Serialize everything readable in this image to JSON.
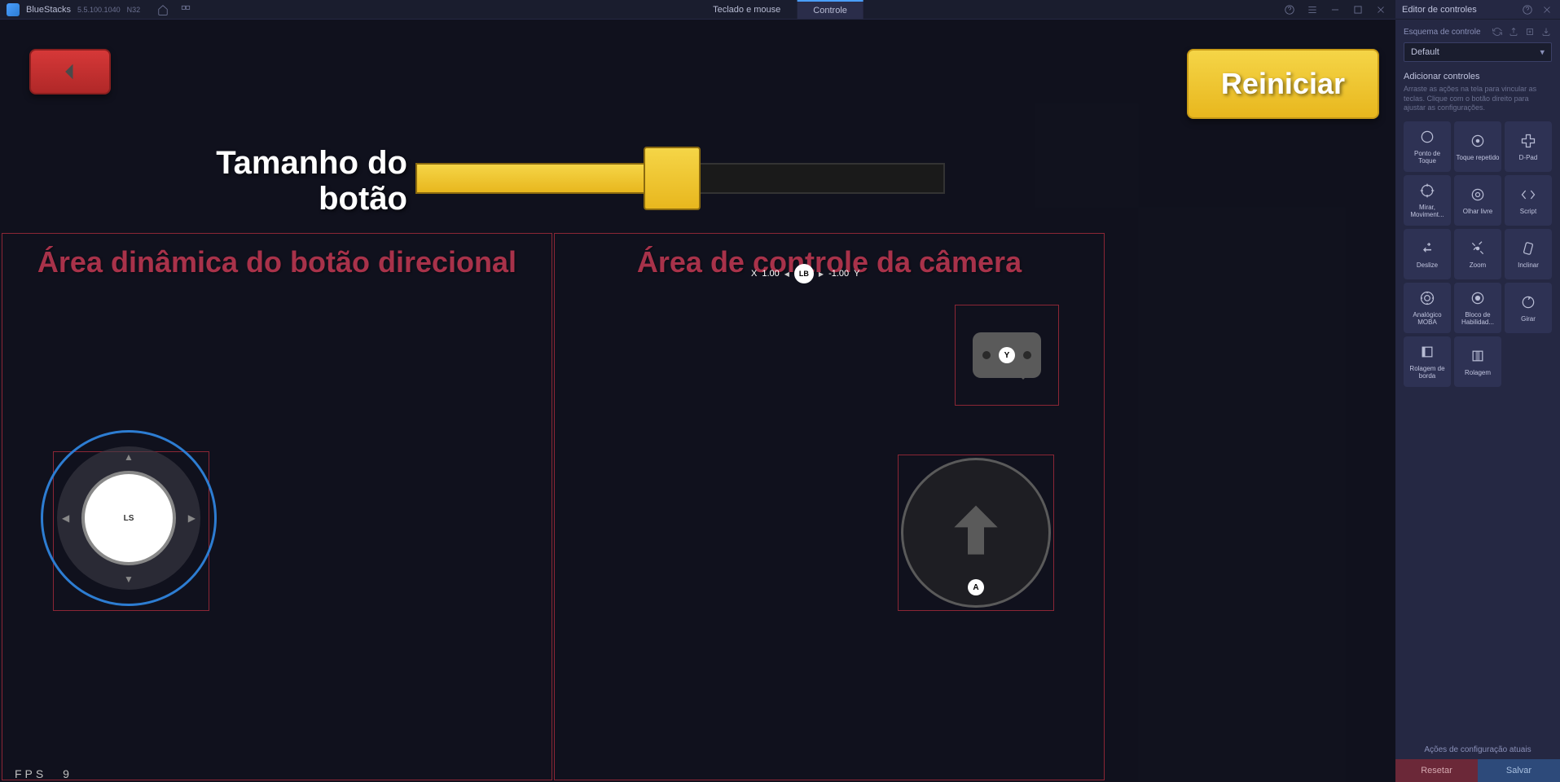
{
  "titlebar": {
    "app_name": "BlueStacks",
    "version": "5.5.100.1040",
    "instance": "N32",
    "tabs": [
      {
        "label": "Teclado e mouse",
        "active": false
      },
      {
        "label": "Controle",
        "active": true
      }
    ]
  },
  "game": {
    "size_label": "Tamanho do botão",
    "reset_label": "Reiniciar",
    "zone_left": "Área dinâmica do botão direcional",
    "zone_right": "Área de controle da câmera",
    "lb": {
      "prefix": "X",
      "left": "1.00",
      "button": "LB",
      "right": "-1.00",
      "suffix": "Y"
    },
    "joystick_label": "LS",
    "chat_button": "Y",
    "arrow_button": "A",
    "fps_label": "FPS",
    "fps_value": "9"
  },
  "sidebar": {
    "title": "Editor de controles",
    "scheme_label": "Esquema de controle",
    "scheme_value": "Default",
    "add_title": "Adicionar controles",
    "add_desc": "Arraste as ações na tela para vincular as teclas. Clique com o botão direito para ajustar as configurações.",
    "controls": [
      {
        "name": "Ponto de Toque",
        "icon": "circle"
      },
      {
        "name": "Toque repetido",
        "icon": "circle-dot"
      },
      {
        "name": "D-Pad",
        "icon": "dpad"
      },
      {
        "name": "Mirar, Moviment...",
        "icon": "crosshair"
      },
      {
        "name": "Olhar livre",
        "icon": "eye-circle"
      },
      {
        "name": "Script",
        "icon": "script"
      },
      {
        "name": "Deslize",
        "icon": "swipe"
      },
      {
        "name": "Zoom",
        "icon": "zoom"
      },
      {
        "name": "Inclinar",
        "icon": "tilt"
      },
      {
        "name": "Analógico MOBA",
        "icon": "moba"
      },
      {
        "name": "Bloco de Habilidad...",
        "icon": "skill"
      },
      {
        "name": "Girar",
        "icon": "rotate"
      },
      {
        "name": "Rolagem de borda",
        "icon": "edge-scroll"
      },
      {
        "name": "Rolagem",
        "icon": "scroll"
      }
    ],
    "config_actions": "Ações de configuração atuais",
    "btn_reset": "Resetar",
    "btn_save": "Salvar"
  }
}
